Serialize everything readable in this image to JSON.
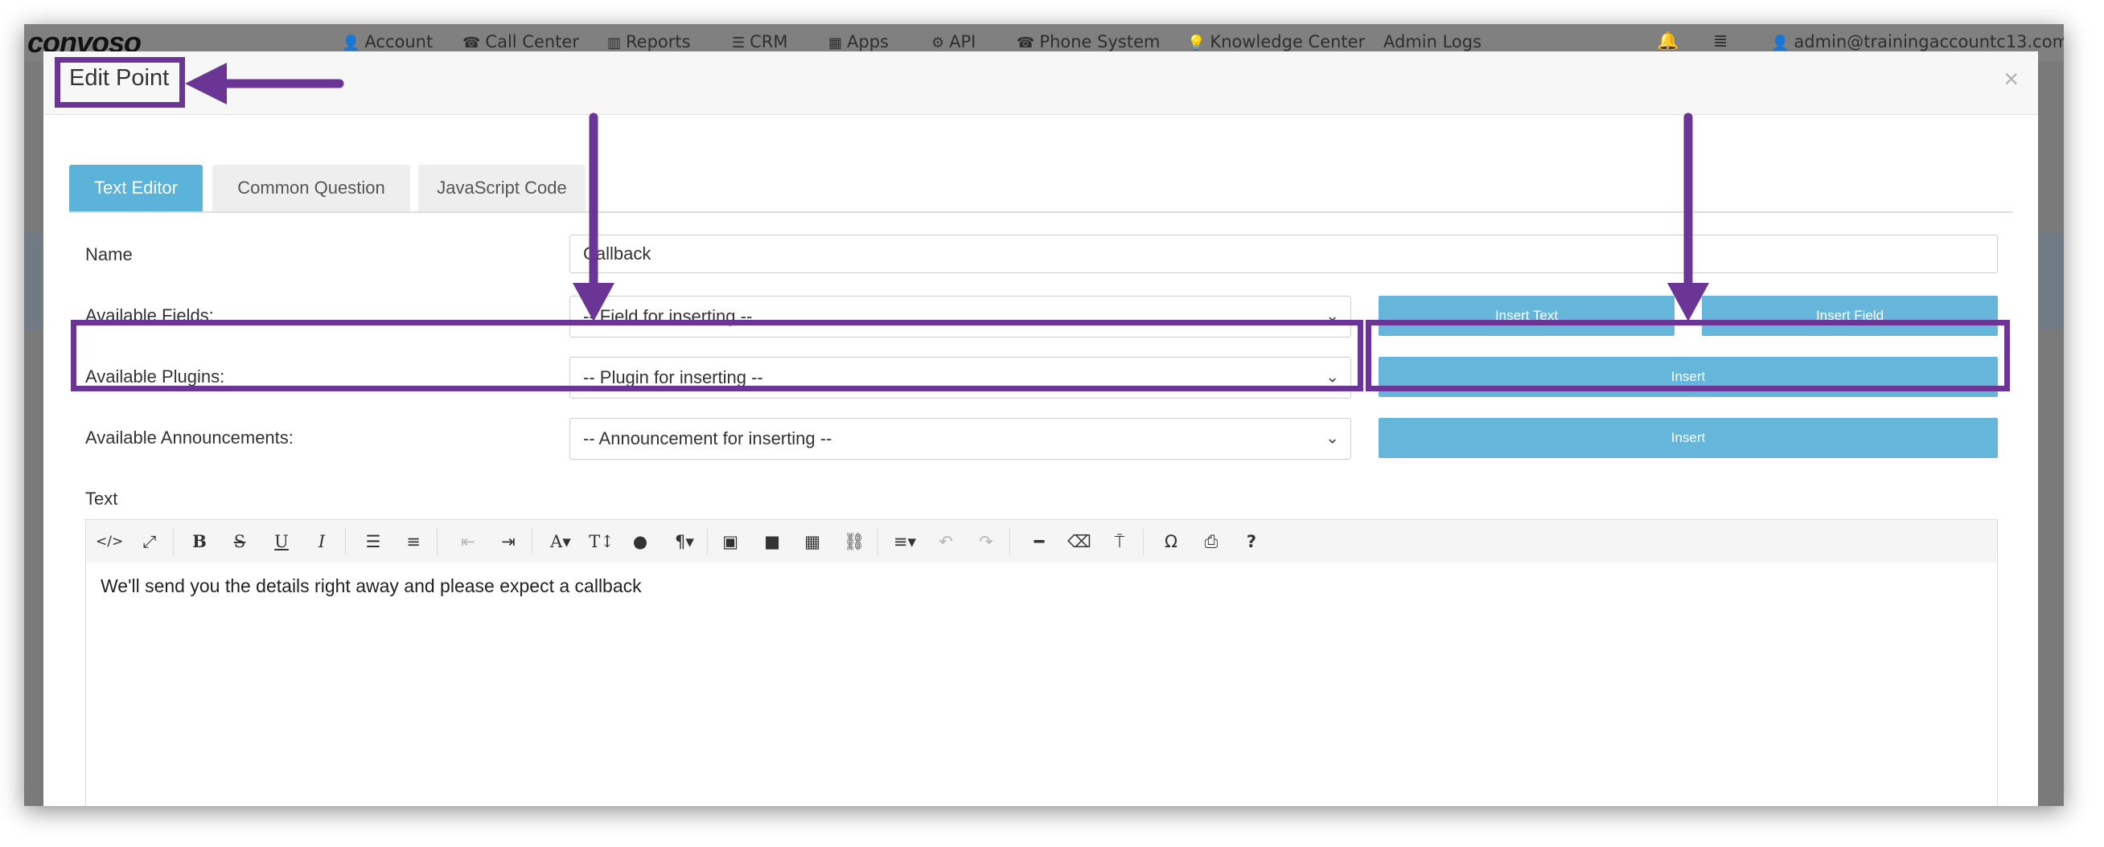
{
  "brand": "convoso",
  "topnav": {
    "items": [
      {
        "icon": "user-icon",
        "label": "Account"
      },
      {
        "icon": "phone-icon",
        "label": "Call Center"
      },
      {
        "icon": "bar-chart-icon",
        "label": "Reports"
      },
      {
        "icon": "list-icon",
        "label": "CRM"
      },
      {
        "icon": "grid-icon",
        "label": "Apps"
      },
      {
        "icon": "gear-icon",
        "label": "API"
      },
      {
        "icon": "phone-icon",
        "label": "Phone System"
      },
      {
        "icon": "lightbulb-icon",
        "label": "Knowledge Center"
      },
      {
        "icon": "",
        "label": "Admin Logs"
      }
    ],
    "user": "admin@trainingaccountc13.com"
  },
  "modal": {
    "title": "Edit Point",
    "close": "×",
    "tabs": [
      {
        "label": "Text Editor",
        "active": true
      },
      {
        "label": "Common Question",
        "active": false
      },
      {
        "label": "JavaScript Code",
        "active": false
      }
    ],
    "form": {
      "name": {
        "label": "Name",
        "value": "Callback"
      },
      "fields": {
        "label": "Available Fields:",
        "placeholder": "-- Field for inserting --",
        "btn_text": "Insert Text",
        "btn_field": "Insert Field"
      },
      "plugins": {
        "label": "Available Plugins:",
        "placeholder": "-- Plugin for inserting --",
        "btn": "Insert"
      },
      "announcements": {
        "label": "Available Announcements:",
        "placeholder": "-- Announcement for inserting --",
        "btn": "Insert"
      },
      "text_label": "Text"
    },
    "editor": {
      "content": "We'll send you the details right away and please expect a callback",
      "toolbar": [
        "code-view",
        "fullscreen",
        "bold",
        "strikethrough",
        "underline",
        "italic",
        "unordered-list",
        "ordered-list",
        "outdent",
        "indent",
        "font-family",
        "font-size",
        "color",
        "paragraph",
        "image",
        "video",
        "table",
        "link",
        "align",
        "undo",
        "redo",
        "horizontal-rule",
        "eraser",
        "paint-format",
        "special-char",
        "print",
        "help"
      ]
    }
  },
  "colors": {
    "accent": "#5bb3d9",
    "annotation": "#6b3596"
  }
}
